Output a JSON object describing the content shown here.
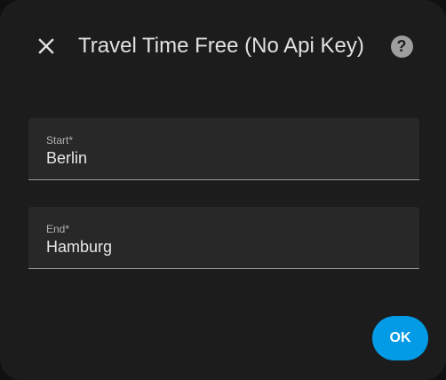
{
  "dialog": {
    "title": "Travel Time Free (No Api Key)",
    "close_icon": "close-icon",
    "help_icon": "help-circle-icon",
    "help_glyph": "?"
  },
  "form": {
    "start": {
      "label": "Start*",
      "value": "Berlin"
    },
    "end": {
      "label": "End*",
      "value": "Hamburg"
    }
  },
  "actions": {
    "ok_label": "OK"
  },
  "colors": {
    "dialog_background": "#1c1c1c",
    "field_background": "#282828",
    "accent": "#039be5",
    "text_primary": "#e1e1e1",
    "text_secondary": "#b3b3b3"
  }
}
